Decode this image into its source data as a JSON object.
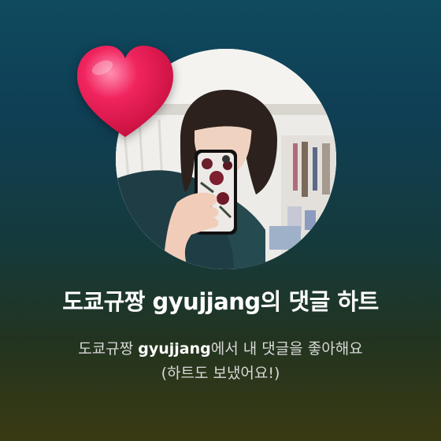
{
  "notification": {
    "title": "도쿄규짱 gyujjang의 댓글 하트",
    "body_prefix": "도쿄규짱 ",
    "body_username": "gyujjang",
    "body_suffix": "에서 내 댓글을 좋아해요",
    "body_line2": "(하트도 보냈어요!)"
  },
  "avatar": {
    "icon": "profile-photo"
  },
  "heart": {
    "icon": "heart-icon",
    "color": "#e8174d"
  },
  "colors": {
    "background_top": "#0f4a5e",
    "background_bottom": "#3a3a12",
    "title": "#ffffff",
    "body": "#d8d8d8"
  }
}
